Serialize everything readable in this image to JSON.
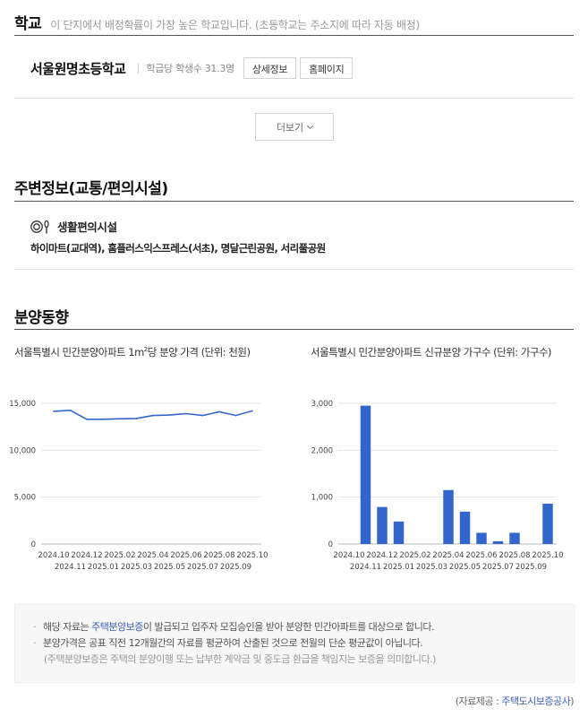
{
  "school": {
    "title": "학교",
    "desc": "이 단지에서 배정확률이 가장 높은 학교입니다. (초등학교는 주소지에 따라 자동 배정)",
    "name": "서울원명초등학교",
    "stat": "학급당 학생수 31.3명",
    "detail_btn": "상세정보",
    "homepage_btn": "홈페이지",
    "more_btn": "더보기"
  },
  "nearby": {
    "title": "주변정보(교통/편의시설)",
    "category_icon": "dining-icon",
    "category": "생활편의시설",
    "places": "하이마트(교대역), 홈플러스익스프레스(서초), 명달근린공원, 서리풀공원"
  },
  "sales": {
    "title": "분양동향",
    "price_chart_title_pre": "서울특별시 민간분양아파트 1m",
    "price_chart_title_sup": "2",
    "price_chart_title_post": "당 분양 가격 (단위: 천원)",
    "supply_chart_title": "서울특별시 민간분양아파트 신규분양 가구수 (단위: 가구수)"
  },
  "chart_data": [
    {
      "type": "line",
      "title": "서울특별시 민간분양아파트 1m²당 분양 가격 (단위: 천원)",
      "x": [
        "2024.10",
        "2024.11",
        "2024.12",
        "2025.01",
        "2025.02",
        "2025.03",
        "2025.04",
        "2025.05",
        "2025.06",
        "2025.07",
        "2025.08",
        "2025.09",
        "2025.10"
      ],
      "values": [
        14150,
        14250,
        13300,
        13300,
        13350,
        13380,
        13700,
        13750,
        13900,
        13700,
        14100,
        13700,
        14200
      ],
      "ylim": [
        0,
        15000
      ],
      "yticks": [
        "0",
        "5,000",
        "10,000",
        "15,000"
      ],
      "ytick_values": [
        0,
        5000,
        10000,
        15000
      ],
      "color": "#3366cc",
      "grid": true
    },
    {
      "type": "bar",
      "title": "서울특별시 민간분양아파트 신규분양 가구수 (단위: 가구수)",
      "x": [
        "2024.10",
        "2024.11",
        "2024.12",
        "2025.01",
        "2025.02",
        "2025.03",
        "2025.04",
        "2025.05",
        "2025.06",
        "2025.07",
        "2025.08",
        "2025.09",
        "2025.10"
      ],
      "values": [
        0,
        2950,
        790,
        480,
        0,
        0,
        1150,
        690,
        240,
        60,
        240,
        0,
        860
      ],
      "ylim": [
        0,
        3000
      ],
      "yticks": [
        "0",
        "1,000",
        "2,000",
        "3,000"
      ],
      "ytick_values": [
        0,
        1000,
        2000,
        3000
      ],
      "color": "#3366cc",
      "grid": true
    }
  ],
  "notice": {
    "line1_pre": "해당 자료는 ",
    "line1_link": "주택분양보증",
    "line1_post": "이 발급되고 입주자 모집승인을 받아 분양한 민간아파트를 대상으로 합니다.",
    "line2": "분양가격은 공표 직전 12개월간의 자료를 평균하여 산출된 것으로 전월의 단순 평균값이 아닙니다.",
    "line3": "(주택분양보증은 주택의 분양이행 또는 납부한 계약금 및 중도금 환급을 책임지는 보증을 의미합니다.)"
  },
  "source": {
    "prefix": "(자료제공 : ",
    "link": "주택도시보증공사",
    "suffix": ")"
  }
}
